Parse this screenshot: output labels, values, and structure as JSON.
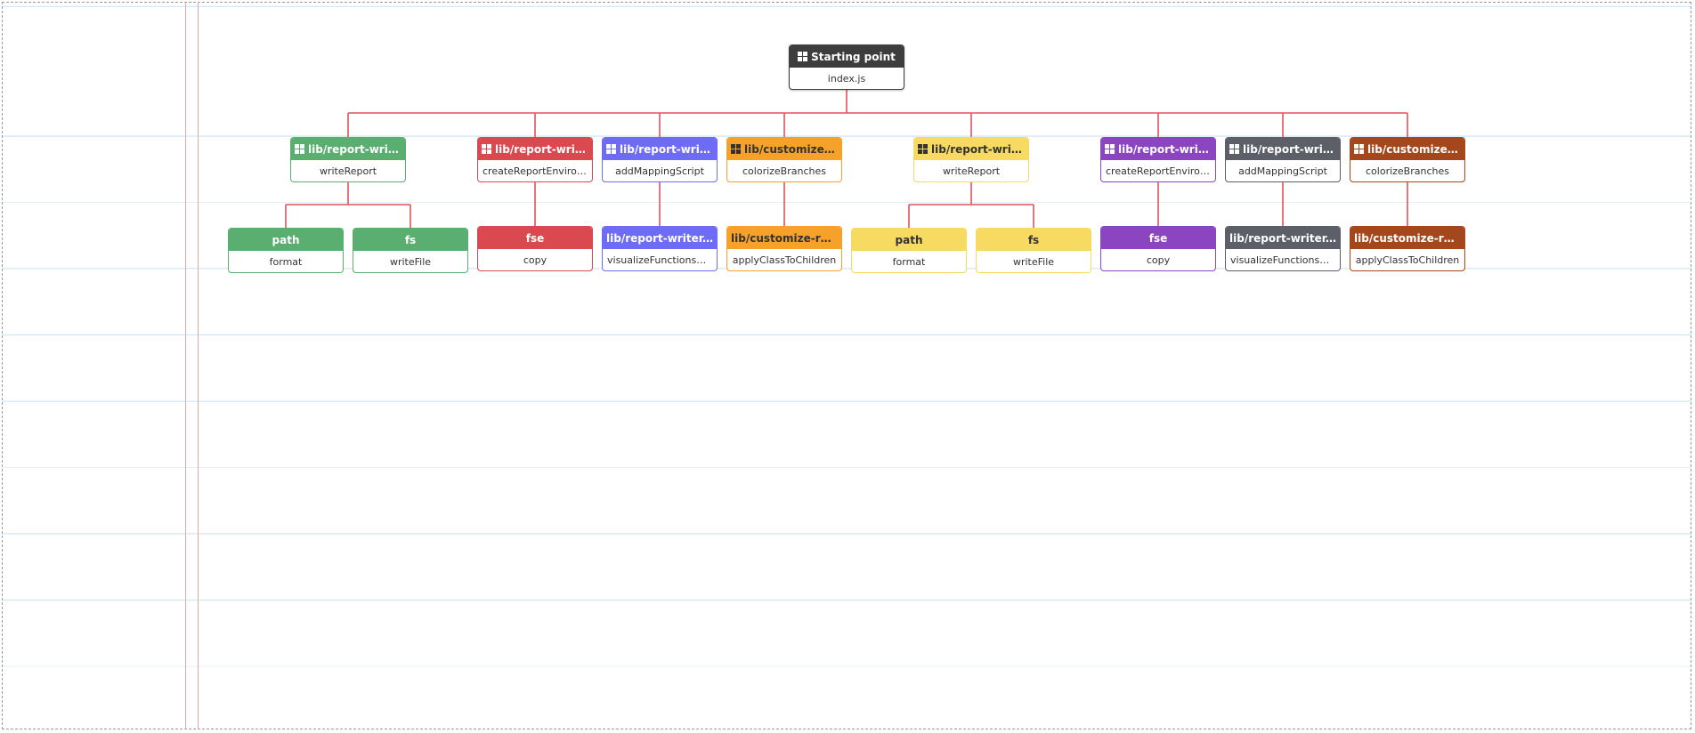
{
  "diagram": {
    "edge_color": "#e0545a",
    "root": {
      "title": "Starting point",
      "body": "index.js",
      "icon": "grid-icon",
      "color": "#3d3d3d",
      "text": "#ffffff",
      "children": [
        {
          "title": "lib/report-writer.js",
          "body": "writeReport",
          "icon": "grid-icon",
          "color": "#5aae70",
          "text": "#ffffff",
          "children": [
            {
              "title": "path",
              "body": "format",
              "color": "#5aae70",
              "text": "#ffffff"
            },
            {
              "title": "fs",
              "body": "writeFile",
              "color": "#5aae70",
              "text": "#ffffff"
            }
          ]
        },
        {
          "title": "lib/report-writer.js",
          "body": "createReportEnvironment",
          "icon": "grid-icon",
          "color": "#d9494f",
          "text": "#ffffff",
          "children": [
            {
              "title": "fse",
              "body": "copy",
              "color": "#d9494f",
              "text": "#ffffff"
            }
          ]
        },
        {
          "title": "lib/report-writer.js",
          "body": "addMappingScript",
          "icon": "grid-icon",
          "color": "#6e6bf5",
          "text": "#ffffff",
          "children": [
            {
              "title": "lib/report-writer.js",
              "body": "visualizeFunctionsMapping",
              "color": "#6e6bf5",
              "text": "#ffffff"
            }
          ]
        },
        {
          "title": "lib/customize-report.js",
          "body": "colorizeBranches",
          "icon": "grid-icon",
          "color": "#f5a12a",
          "text": "#333333",
          "children": [
            {
              "title": "lib/customize-report.js",
              "body": "applyClassToChildren",
              "color": "#f5a12a",
              "text": "#333333"
            }
          ]
        },
        {
          "title": "lib/report-writer.js",
          "body": "writeReport",
          "icon": "grid-icon",
          "color": "#f7da62",
          "text": "#333333",
          "children": [
            {
              "title": "path",
              "body": "format",
              "color": "#f7da62",
              "text": "#333333"
            },
            {
              "title": "fs",
              "body": "writeFile",
              "color": "#f7da62",
              "text": "#333333"
            }
          ]
        },
        {
          "title": "lib/report-writer.js",
          "body": "createReportEnvironment",
          "icon": "grid-icon",
          "color": "#8c45c0",
          "text": "#ffffff",
          "children": [
            {
              "title": "fse",
              "body": "copy",
              "color": "#8c45c0",
              "text": "#ffffff"
            }
          ]
        },
        {
          "title": "lib/report-writer.js",
          "body": "addMappingScript",
          "icon": "grid-icon",
          "color": "#5d5f68",
          "text": "#ffffff",
          "children": [
            {
              "title": "lib/report-writer.js",
              "body": "visualizeFunctionsMapping",
              "color": "#5d5f68",
              "text": "#ffffff"
            }
          ]
        },
        {
          "title": "lib/customize-report.js",
          "body": "colorizeBranches",
          "icon": "grid-icon",
          "color": "#a5471c",
          "text": "#ffffff",
          "children": [
            {
              "title": "lib/customize-report.js",
              "body": "applyClassToChildren",
              "color": "#a5471c",
              "text": "#ffffff"
            }
          ]
        }
      ]
    }
  }
}
